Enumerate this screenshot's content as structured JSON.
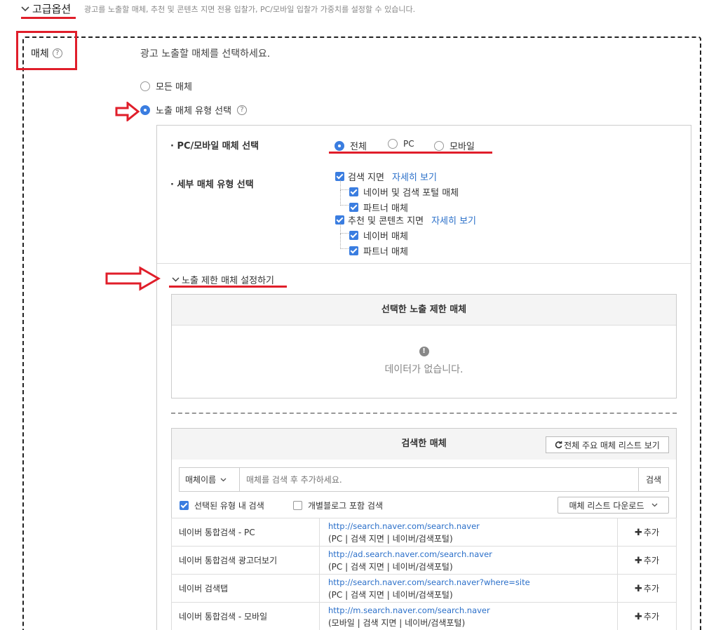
{
  "advanced": {
    "title": "고급옵션",
    "description": "광고를 노출할 매체, 추천 및 콘텐츠 지면 전용 입찰가, PC/모바일 입찰가 가중치를 설정할 수 있습니다."
  },
  "media": {
    "label": "매체",
    "help": "?",
    "instruction": "광고 노출할 매체를 선택하세요.",
    "options": [
      {
        "label": "모든 매체",
        "selected": false
      },
      {
        "label": "노출 매체 유형 선택",
        "selected": true
      }
    ]
  },
  "device": {
    "label": "· PC/모바일 매체 선택",
    "options": [
      {
        "label": "전체",
        "selected": true
      },
      {
        "label": "PC",
        "selected": false
      },
      {
        "label": "모바일",
        "selected": false
      }
    ]
  },
  "detail": {
    "label": "· 세부 매체 유형 선택",
    "search": {
      "label": "검색 지면",
      "link": "자세히 보기",
      "children": [
        "네이버 및 검색 포털 매체",
        "파트너 매체"
      ]
    },
    "content": {
      "label": "추천 및 콘텐츠 지면",
      "link": "자세히 보기",
      "children": [
        "네이버 매체",
        "파트너 매체"
      ]
    }
  },
  "restrict": {
    "toggle": "노출 제한 매체 설정하기",
    "selected_title": "선택한 노출 제한 매체",
    "empty": "데이터가 없습니다.",
    "searched_title": "검색한 매체",
    "list_button": "전체 주요 매체 리스트 보기",
    "search_type": "매체이름",
    "search_placeholder": "매체를 검색 후 추가하세요.",
    "search_button": "검색",
    "filter_selected": "선택된 유형 내 검색",
    "filter_blog": "개별블로그 포함 검색",
    "download": "매체 리스트 다운로드",
    "add_label": "추가",
    "rows": [
      {
        "name": "네이버 통합검색 - PC",
        "url": "http://search.naver.com/search.naver",
        "meta": "(PC | 검색 지면 | 네이버/검색포털)"
      },
      {
        "name": "네이버 통합검색 광고더보기",
        "url": "http://ad.search.naver.com/search.naver",
        "meta": "(PC | 검색 지면 | 네이버/검색포털)"
      },
      {
        "name": "네이버 검색탭",
        "url": "http://search.naver.com/search.naver?where=site",
        "meta": "(PC | 검색 지면 | 네이버/검색포털)"
      },
      {
        "name": "네이버 통합검색 - 모바일",
        "url": "http://m.search.naver.com/search.naver",
        "meta": "(모바일 | 검색 지면 | 네이버/검색포털)"
      }
    ]
  },
  "colors": {
    "accent": "#3a7de0",
    "annotation": "#e01e2a",
    "link": "#2a6fc9"
  }
}
